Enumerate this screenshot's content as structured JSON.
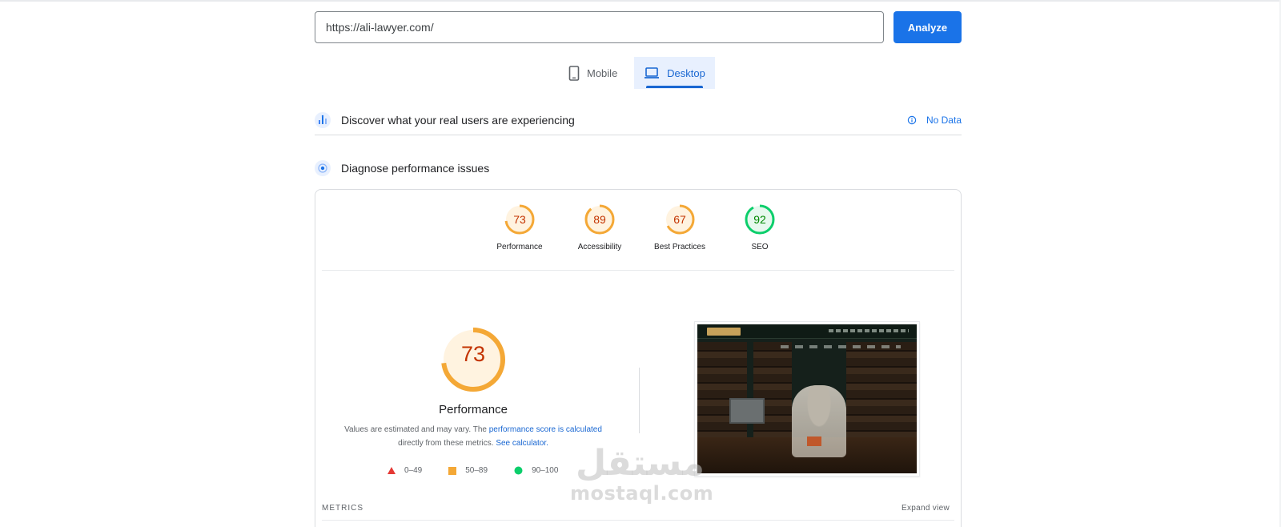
{
  "search": {
    "url_value": "https://ali-lawyer.com/",
    "analyze_label": "Analyze"
  },
  "device_tabs": [
    {
      "label": "Mobile",
      "icon": "smartphone-icon",
      "selected": false
    },
    {
      "label": "Desktop",
      "icon": "laptop-icon",
      "selected": true
    }
  ],
  "crux": {
    "title": "Discover what your real users are experiencing",
    "status_label": "No Data",
    "icon": "crux-bars-icon"
  },
  "diagnose": {
    "title": "Diagnose performance issues",
    "icon": "lighthouse-icon"
  },
  "categories": [
    {
      "label": "Performance",
      "score": 73,
      "rating": "average"
    },
    {
      "label": "Accessibility",
      "score": 89,
      "rating": "average"
    },
    {
      "label": "Best Practices",
      "score": 67,
      "rating": "average"
    },
    {
      "label": "SEO",
      "score": 92,
      "rating": "pass"
    }
  ],
  "performance": {
    "score": 73,
    "title": "Performance",
    "note_prefix": "Values are estimated and may vary. The ",
    "note_link1": "performance score is calculated",
    "note_mid": "directly from these metrics. ",
    "note_link2": "See calculator."
  },
  "legend": [
    {
      "range": "0–49",
      "shape": "triangle",
      "color": "#e53935"
    },
    {
      "range": "50–89",
      "shape": "square",
      "color": "#f4a836"
    },
    {
      "range": "90–100",
      "shape": "circle",
      "color": "#0cce6b"
    }
  ],
  "metrics": {
    "label": "METRICS",
    "expand_label": "Expand view"
  },
  "colors": {
    "accent": "#1a73e8",
    "average": "#f4a836",
    "average_text": "#c33300",
    "average_fill": "#fff3e0",
    "pass": "#0cce6b",
    "pass_text": "#008800",
    "pass_fill": "#e6f8ee"
  },
  "watermark": {
    "arabic": "مستقل",
    "latin": "mostaql.com"
  }
}
